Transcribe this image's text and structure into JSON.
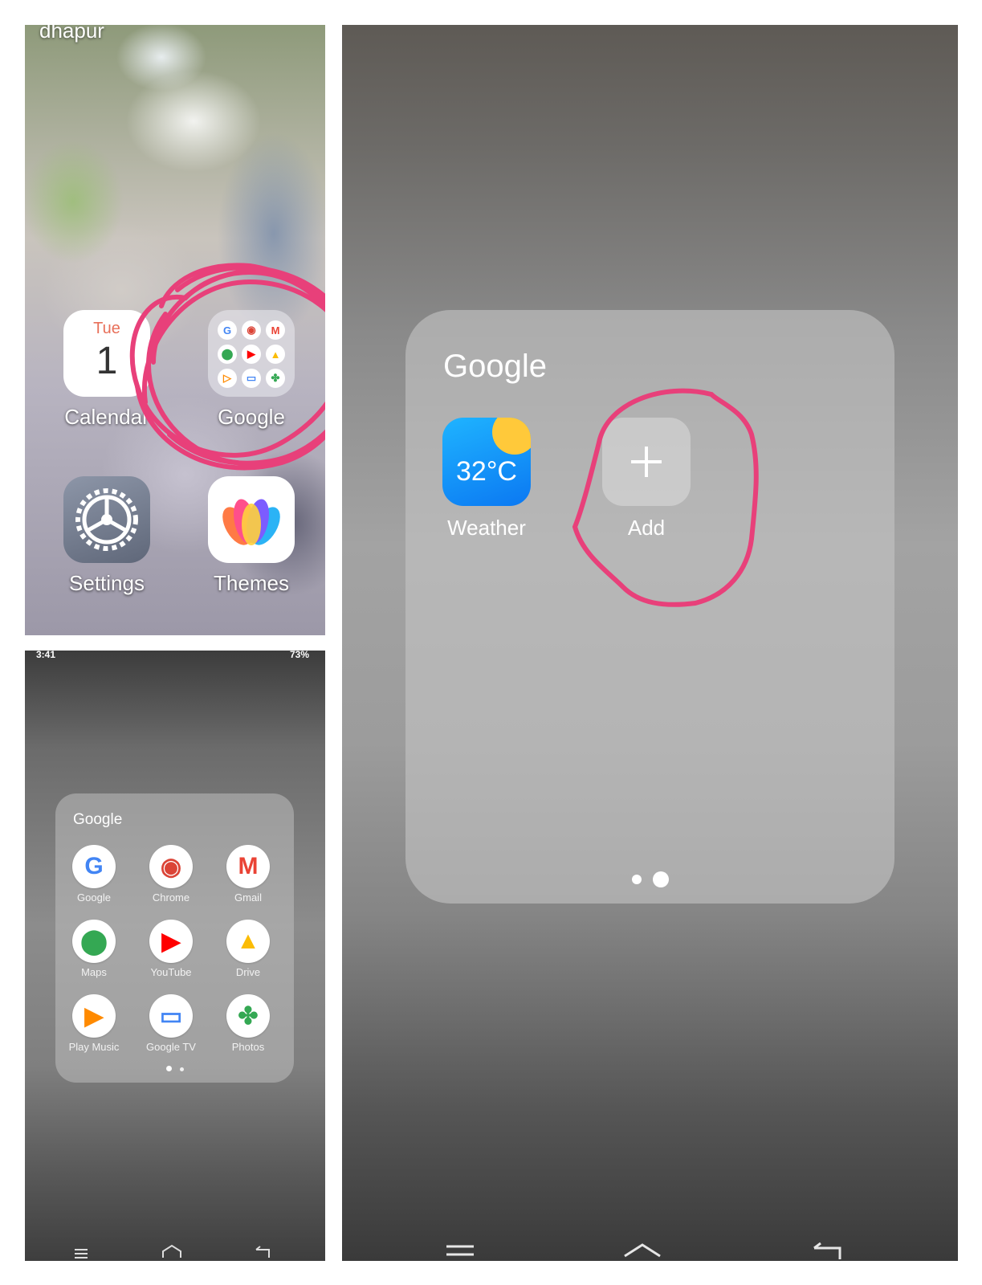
{
  "home": {
    "top_text": "dhapur",
    "apps": [
      {
        "label": "Calendar",
        "day": "Tue",
        "date": "1"
      },
      {
        "label": "Google"
      },
      {
        "label": "Settings"
      },
      {
        "label": "Themes"
      }
    ],
    "folder_preview_letters": [
      "G",
      "◉",
      "M",
      "⬤",
      "▶",
      "▲",
      "▷",
      "▭",
      "✤"
    ]
  },
  "small_folder": {
    "status_left": "3:41",
    "status_right": "73%",
    "title": "Google",
    "apps": [
      {
        "label": "Google",
        "glyph": "G",
        "color": "#4285f4"
      },
      {
        "label": "Chrome",
        "glyph": "◉",
        "color": "#db4437"
      },
      {
        "label": "Gmail",
        "glyph": "M",
        "color": "#ea4335"
      },
      {
        "label": "Maps",
        "glyph": "⬤",
        "color": "#34a853"
      },
      {
        "label": "YouTube",
        "glyph": "▶",
        "color": "#ff0000"
      },
      {
        "label": "Drive",
        "glyph": "▲",
        "color": "#fbbc05"
      },
      {
        "label": "Play Music",
        "glyph": "▶",
        "color": "#ff8a00"
      },
      {
        "label": "Google TV",
        "glyph": "▭",
        "color": "#4285f4"
      },
      {
        "label": "Photos",
        "glyph": "✤",
        "color": "#34a853"
      }
    ]
  },
  "large_folder": {
    "title": "Google",
    "apps": [
      {
        "label": "Weather",
        "temp": "32°C"
      },
      {
        "label": "Add",
        "glyph": "+"
      }
    ]
  },
  "colors": {
    "annotation": "#e8407a",
    "add_icon_bg": "#d9d9d9",
    "weather_blue": "#0b78f2"
  }
}
